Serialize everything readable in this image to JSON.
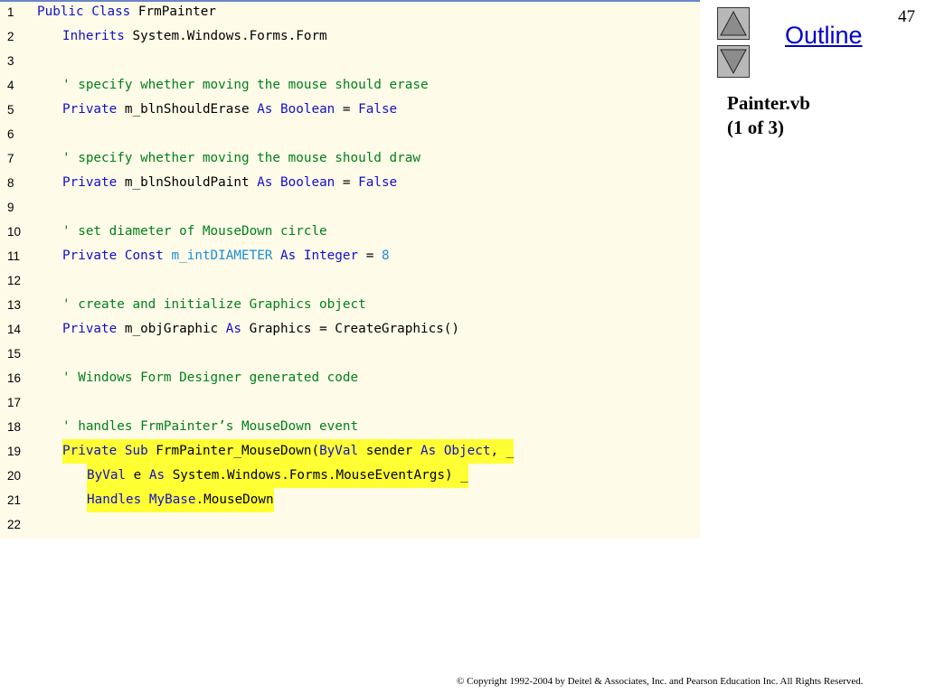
{
  "slide": {
    "number": "47",
    "outline_label": "Outline",
    "side_title_line1": "Painter.vb",
    "side_title_line2": "(1 of 3)",
    "copyright": "© Copyright 1992-2004 by Deitel & Associates, Inc. and Pearson Education Inc. All Rights Reserved."
  },
  "colors": {
    "keyword": "#1010c8",
    "comment": "#00801a",
    "constant": "#1a8fd8",
    "highlight": "#ffff33",
    "panel_background": "#fffbe9"
  },
  "icons": {
    "up": "triangle-up-icon",
    "down": "triangle-down-icon"
  },
  "code_lines": [
    {
      "num": "1",
      "indent": 0,
      "hl": false,
      "tokens": [
        {
          "t": "Public Class",
          "c": "kw"
        },
        {
          "t": " FrmPainter",
          "c": "tx"
        }
      ]
    },
    {
      "num": "2",
      "indent": 1,
      "hl": false,
      "tokens": [
        {
          "t": "Inherits",
          "c": "kw"
        },
        {
          "t": " System.Windows.Forms.Form",
          "c": "tx"
        }
      ]
    },
    {
      "num": "3",
      "indent": 0,
      "hl": false,
      "tokens": []
    },
    {
      "num": "4",
      "indent": 1,
      "hl": false,
      "tokens": [
        {
          "t": "' specify whether moving the mouse should erase",
          "c": "cm"
        }
      ]
    },
    {
      "num": "5",
      "indent": 1,
      "hl": false,
      "tokens": [
        {
          "t": "Private",
          "c": "kw"
        },
        {
          "t": " m_blnShouldErase ",
          "c": "tx"
        },
        {
          "t": "As",
          "c": "kw"
        },
        {
          "t": " ",
          "c": "tx"
        },
        {
          "t": "Boolean",
          "c": "kw"
        },
        {
          "t": " = ",
          "c": "tx"
        },
        {
          "t": "False",
          "c": "kw"
        }
      ]
    },
    {
      "num": "6",
      "indent": 0,
      "hl": false,
      "tokens": []
    },
    {
      "num": "7",
      "indent": 1,
      "hl": false,
      "tokens": [
        {
          "t": "' specify whether moving the mouse should draw",
          "c": "cm"
        }
      ]
    },
    {
      "num": "8",
      "indent": 1,
      "hl": false,
      "tokens": [
        {
          "t": "Private",
          "c": "kw"
        },
        {
          "t": " m_blnShouldPaint ",
          "c": "tx"
        },
        {
          "t": "As",
          "c": "kw"
        },
        {
          "t": " ",
          "c": "tx"
        },
        {
          "t": "Boolean",
          "c": "kw"
        },
        {
          "t": " = ",
          "c": "tx"
        },
        {
          "t": "False",
          "c": "kw"
        }
      ]
    },
    {
      "num": "9",
      "indent": 0,
      "hl": false,
      "tokens": []
    },
    {
      "num": "10",
      "indent": 1,
      "hl": false,
      "tokens": [
        {
          "t": "' set diameter of MouseDown circle",
          "c": "cm"
        }
      ]
    },
    {
      "num": "11",
      "indent": 1,
      "hl": false,
      "tokens": [
        {
          "t": "Private Const",
          "c": "kw"
        },
        {
          "t": " ",
          "c": "tx"
        },
        {
          "t": "m_intDIAMETER",
          "c": "cn"
        },
        {
          "t": " ",
          "c": "tx"
        },
        {
          "t": "As",
          "c": "kw"
        },
        {
          "t": " ",
          "c": "tx"
        },
        {
          "t": "Integer",
          "c": "kw"
        },
        {
          "t": " = ",
          "c": "tx"
        },
        {
          "t": "8",
          "c": "cn"
        }
      ]
    },
    {
      "num": "12",
      "indent": 0,
      "hl": false,
      "tokens": []
    },
    {
      "num": "13",
      "indent": 1,
      "hl": false,
      "tokens": [
        {
          "t": "' create and initialize Graphics object",
          "c": "cm"
        }
      ]
    },
    {
      "num": "14",
      "indent": 1,
      "hl": false,
      "tokens": [
        {
          "t": "Private",
          "c": "kw"
        },
        {
          "t": " m_objGraphic ",
          "c": "tx"
        },
        {
          "t": "As",
          "c": "kw"
        },
        {
          "t": " Graphics = CreateGraphics()",
          "c": "tx"
        }
      ]
    },
    {
      "num": "15",
      "indent": 0,
      "hl": false,
      "tokens": []
    },
    {
      "num": "16",
      "indent": 1,
      "hl": false,
      "tokens": [
        {
          "t": "' Windows Form Designer generated code",
          "c": "cm"
        }
      ]
    },
    {
      "num": "17",
      "indent": 0,
      "hl": false,
      "tokens": []
    },
    {
      "num": "18",
      "indent": 1,
      "hl": false,
      "tokens": [
        {
          "t": "' handles FrmPainter’s MouseDown event",
          "c": "cm"
        }
      ]
    },
    {
      "num": "19",
      "indent": 1,
      "hl": true,
      "tokens": [
        {
          "t": "Private Sub",
          "c": "kw"
        },
        {
          "t": " FrmPainter_MouseDown(",
          "c": "tx"
        },
        {
          "t": "ByVal",
          "c": "kw"
        },
        {
          "t": " sender ",
          "c": "tx"
        },
        {
          "t": "As",
          "c": "kw"
        },
        {
          "t": " ",
          "c": "tx"
        },
        {
          "t": "Object",
          "c": "kw"
        },
        {
          "t": ", _",
          "c": "tx"
        }
      ]
    },
    {
      "num": "20",
      "indent": 2,
      "hl": true,
      "tokens": [
        {
          "t": "ByVal",
          "c": "kw"
        },
        {
          "t": " e ",
          "c": "tx"
        },
        {
          "t": "As",
          "c": "kw"
        },
        {
          "t": " System.Windows.Forms.MouseEventArgs) _",
          "c": "tx"
        }
      ]
    },
    {
      "num": "21",
      "indent": 2,
      "hl": true,
      "tokens": [
        {
          "t": "Handles",
          "c": "kw"
        },
        {
          "t": " ",
          "c": "tx"
        },
        {
          "t": "MyBase",
          "c": "kw"
        },
        {
          "t": ".MouseDown",
          "c": "tx"
        }
      ]
    },
    {
      "num": "22",
      "indent": 0,
      "hl": false,
      "tokens": []
    }
  ]
}
